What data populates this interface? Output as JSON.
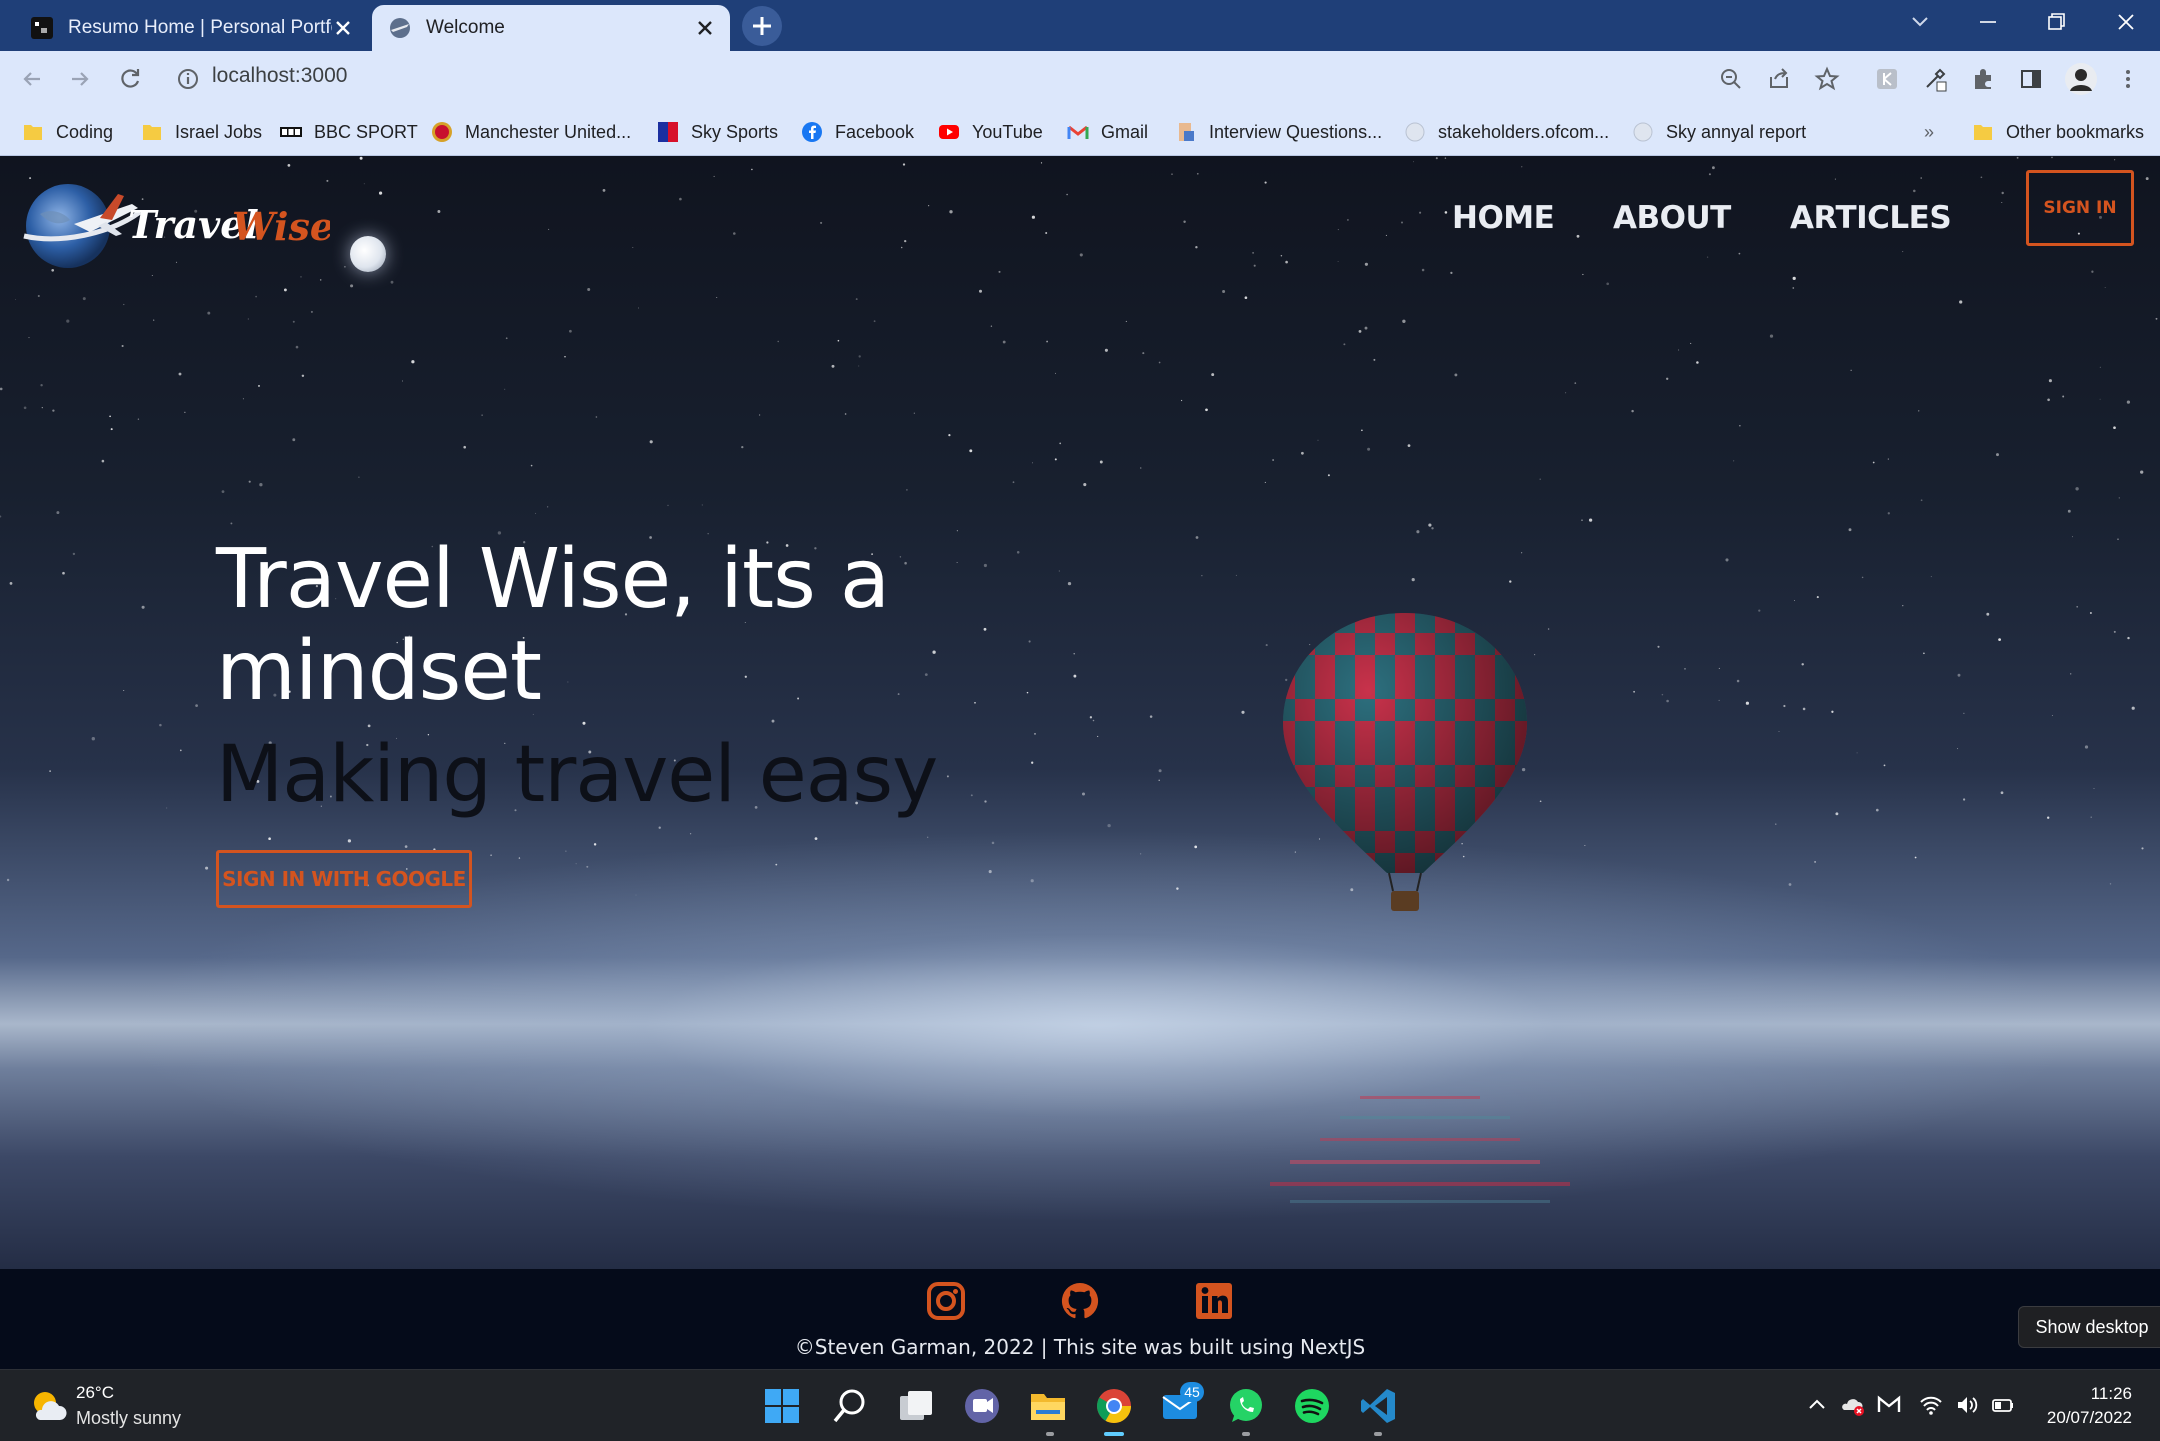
{
  "browser": {
    "tabs": [
      {
        "title": "Resumo Home | Personal Portfoli",
        "active": false
      },
      {
        "title": "Welcome",
        "active": true
      }
    ],
    "url": "localhost:3000",
    "bookmarks": [
      {
        "label": "Coding",
        "icon": "folder-icon"
      },
      {
        "label": "Israel Jobs",
        "icon": "folder-icon"
      },
      {
        "label": "BBC SPORT",
        "icon": "bbc-icon"
      },
      {
        "label": "Manchester United...",
        "icon": "man-utd-icon"
      },
      {
        "label": "Sky Sports",
        "icon": "sky-sports-icon"
      },
      {
        "label": "Facebook",
        "icon": "facebook-icon"
      },
      {
        "label": "YouTube",
        "icon": "youtube-icon"
      },
      {
        "label": "Gmail",
        "icon": "gmail-icon"
      },
      {
        "label": "Interview Questions...",
        "icon": "page-icon"
      },
      {
        "label": "stakeholders.ofcom...",
        "icon": "globe-icon"
      },
      {
        "label": "Sky annyal report",
        "icon": "globe-icon"
      }
    ],
    "more_bookmarks": "»",
    "other_bookmarks": "Other bookmarks"
  },
  "site": {
    "logo_text_1": "Travel",
    "logo_text_2": "Wise",
    "nav": [
      "HOME",
      "ABOUT",
      "ARTICLES"
    ],
    "sign_in": "SIGN IN",
    "hero_title": "Travel Wise, its a mindset",
    "hero_subtitle": "Making travel easy",
    "google_button": "SIGN IN WITH GOOGLE",
    "social": [
      "instagram-icon",
      "github-icon",
      "linkedin-icon"
    ],
    "footer_text": "©Steven Garman, 2022 | This site was built using NextJS",
    "accent_color": "#d4541f"
  },
  "os": {
    "show_desktop": "Show desktop",
    "weather": {
      "temp": "26°C",
      "desc": "Mostly sunny"
    },
    "mail_badge": "45",
    "time": "11:26",
    "date": "20/07/2022"
  }
}
